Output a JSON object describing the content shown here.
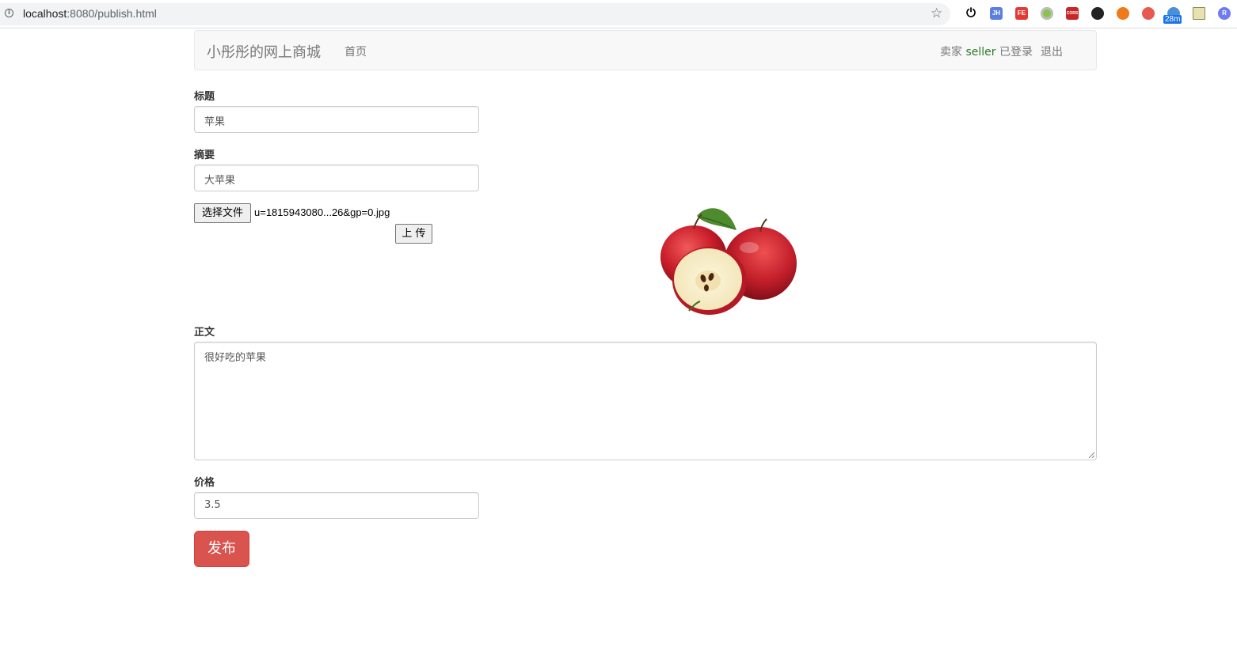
{
  "browser": {
    "url_host": "localhost",
    "url_rest": ":8080/publish.html",
    "extensions": [
      "power-icon",
      "jh-extension-icon",
      "fe-extension-icon",
      "circle-extension-icon",
      "cors-extension-icon",
      "dark-extension-icon",
      "orange-extension-icon",
      "red-extension-icon",
      "timer-extension-icon",
      "notes-extension-icon",
      "r-extension-icon"
    ],
    "ext_labels": {
      "jh": "JH",
      "fe": "FE",
      "cors": "CORS",
      "r": "R"
    },
    "timer_badge": "28m"
  },
  "navbar": {
    "brand": "小彤彤的网上商城",
    "home": "首页",
    "user_prefix": "卖家 ",
    "username": "seller",
    "user_suffix": " 已登录",
    "logout": "退出"
  },
  "form": {
    "title_label": "标题",
    "title_value": "苹果",
    "summary_label": "摘要",
    "summary_value": "大苹果",
    "file_button": "选择文件",
    "file_name": "u=1815943080...26&gp=0.jpg",
    "upload_button": "上 传",
    "body_label": "正文",
    "body_value": "很好吃的苹果",
    "price_label": "价格",
    "price_value": "3.5",
    "publish_button": "发布"
  },
  "colors": {
    "publish_bg": "#d9534f",
    "navbar_bg": "#f8f8f8",
    "username_color": "#2b7a2b"
  }
}
